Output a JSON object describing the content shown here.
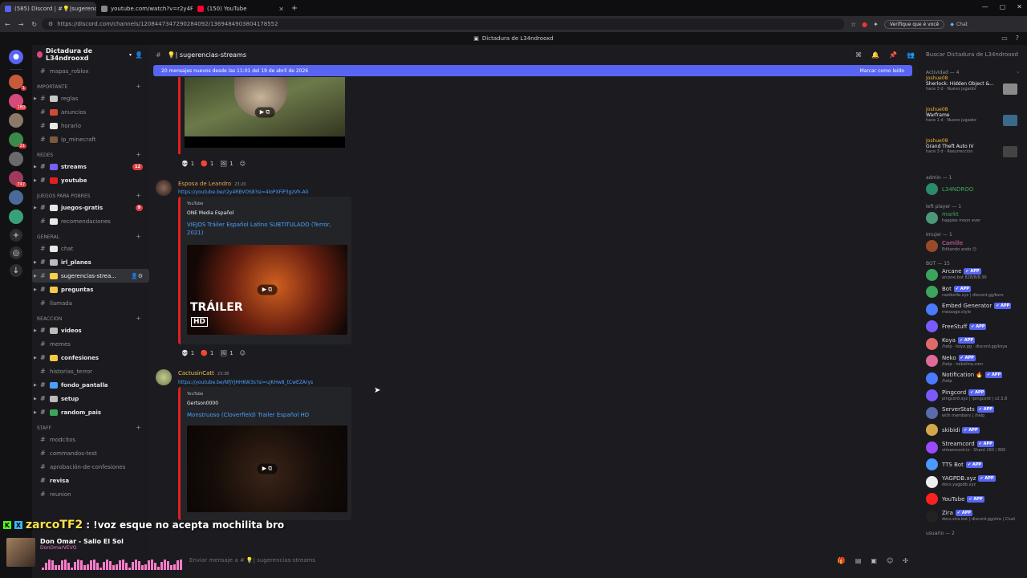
{
  "browser": {
    "tabs": [
      {
        "label": "(585) Discord | #💡|sugerencias-s",
        "color": "#5865f2",
        "active": true
      },
      {
        "label": "youtube.com/watch?v=r2y4RBV",
        "color": "#888",
        "active": false
      },
      {
        "label": "(150) YouTube",
        "color": "#ff0033",
        "active": false
      }
    ],
    "url": "https://discord.com/channels/1208447347290284092/1369484903804178552",
    "verify": "Verifique que é você",
    "chat": "Chat"
  },
  "window_title": "Dictadura de L34ndrooxd",
  "guild": {
    "name": "Dictadura de L34ndrooxd"
  },
  "channels": [
    {
      "kind": "ch",
      "name": "mapas_roblox",
      "emoji_color": "",
      "bold": false
    },
    {
      "kind": "cat",
      "name": "IMPORTANTE"
    },
    {
      "kind": "ch",
      "name": "reglas",
      "emoji_color": "#c8c8c8",
      "arrow": true
    },
    {
      "kind": "ch",
      "name": "anuncios",
      "emoji_color": "#d04a3a"
    },
    {
      "kind": "ch",
      "name": "horario",
      "emoji_color": "#e8e8e8"
    },
    {
      "kind": "ch",
      "name": "ip_minecraft",
      "emoji_color": "#7a5a3a"
    },
    {
      "kind": "cat",
      "name": "REDES"
    },
    {
      "kind": "ch",
      "name": "streams",
      "emoji_color": "#7b5cff",
      "bold": true,
      "arrow": true,
      "badge": "12"
    },
    {
      "kind": "ch",
      "name": "youtube",
      "emoji_color": "#e02020",
      "bold": true,
      "arrow": true
    },
    {
      "kind": "cat",
      "name": "JUEGOS PARA POBRES"
    },
    {
      "kind": "ch",
      "name": "juegos-gratis",
      "emoji_color": "#e8e8e8",
      "bold": true,
      "arrow": true,
      "badge": "9"
    },
    {
      "kind": "ch",
      "name": "recomendaciones",
      "emoji_color": "#e8e8e8"
    },
    {
      "kind": "cat",
      "name": "GENERAL"
    },
    {
      "kind": "ch",
      "name": "chat",
      "emoji_color": "#e8e8e8"
    },
    {
      "kind": "ch",
      "name": "irl_planes",
      "emoji_color": "#bbbbbb",
      "bold": true,
      "arrow": true
    },
    {
      "kind": "ch",
      "name": "sugerencias-strea...",
      "emoji_color": "#f5d04a",
      "selected": true,
      "arrow": true
    },
    {
      "kind": "ch",
      "name": "preguntas",
      "emoji_color": "#f5c84a",
      "bold": true,
      "arrow": true
    },
    {
      "kind": "ch",
      "name": "llamada",
      "emoji_color": ""
    },
    {
      "kind": "cat",
      "name": "REACCION"
    },
    {
      "kind": "ch",
      "name": "videos",
      "emoji_color": "#bbbbbb",
      "bold": true,
      "arrow": true
    },
    {
      "kind": "ch",
      "name": "memes",
      "emoji_color": ""
    },
    {
      "kind": "ch",
      "name": "confesiones",
      "emoji_color": "#f5c84a",
      "bold": true,
      "arrow": true
    },
    {
      "kind": "ch",
      "name": "historias_terror",
      "emoji_color": ""
    },
    {
      "kind": "ch",
      "name": "fondo_pantalla",
      "emoji_color": "#4aa0ff",
      "bold": true,
      "arrow": true
    },
    {
      "kind": "ch",
      "name": "setup",
      "emoji_color": "#bbbbbb",
      "bold": true,
      "arrow": true
    },
    {
      "kind": "ch",
      "name": "random_pais",
      "emoji_color": "#3ba55d",
      "bold": true,
      "arrow": true
    },
    {
      "kind": "cat",
      "name": "STAFF"
    },
    {
      "kind": "ch",
      "name": "modcitos",
      "emoji_color": ""
    },
    {
      "kind": "ch",
      "name": "commandos-test",
      "emoji_color": ""
    },
    {
      "kind": "ch",
      "name": "aprobación-de-confesiones",
      "emoji_color": ""
    },
    {
      "kind": "ch",
      "name": "revisa",
      "emoji_color": "",
      "bold": true
    },
    {
      "kind": "ch",
      "name": "reunion",
      "emoji_color": ""
    }
  ],
  "header": {
    "channel": "💡| sugerencias-streams"
  },
  "banner": {
    "text": "20 mensajes nuevos desde las 11:01 del 19 de abril de 2026",
    "action": "Marcar como leído"
  },
  "messages": [
    {
      "author": "Esposa de Leandro",
      "author_color": "#e8a44a",
      "time": "23:20",
      "link": "https://youtube.be/r2y4RBVOS8?si=4loPXFiP3gzVh-AlI",
      "provider": "YouTube",
      "channel": "ONE Media Español",
      "title": "VIEJOS Tráiler Español Latino SUBTITULADO (Terror, 2021)",
      "overlay": "TRÁILER",
      "overlay2": "HD"
    },
    {
      "author": "CactusinCatt",
      "author_color": "#e8c44a",
      "time": "23:38",
      "link": "https://youtube.be/NfjYJHHKW3s?si=ujKHw8_tCwEZArys",
      "provider": "YouTube",
      "channel": "Gertson0000",
      "title": "Monstruoso (Cloverfield) Trailer Español HD"
    }
  ],
  "reactions": [
    "1",
    "1",
    "1"
  ],
  "composer": {
    "placeholder": "Enviar mensaje a # 💡| sugerencias-streams"
  },
  "members": {
    "search": "Buscar Dictadura de L34ndrooxd",
    "activity_header": "Actividad — 4",
    "activities": [
      {
        "who": "Joshue08",
        "game": "Sherlock: Hidden Object &...",
        "sub": "hace 3 d · Nuevo jugador",
        "color": "#8a8a8a"
      },
      {
        "who": "Joshue08",
        "game": "Warframe",
        "sub": "hace 1 d · Nuevo jugador",
        "color": "#3a6a8a"
      },
      {
        "who": "Joshue08",
        "game": "Grand Theft Auto IV",
        "sub": "hace 3 d · Resurrección",
        "color": "#444"
      }
    ],
    "groups": [
      {
        "title": "admin — 1",
        "items": [
          {
            "name": "L34NDROO",
            "status": "",
            "color": "#3ba55d",
            "av": "#2a8a6a",
            "app": false
          }
        ]
      },
      {
        "title": "left player — 1",
        "items": [
          {
            "name": "markt",
            "status": "happies moon ever",
            "color": "#3ba55d",
            "av": "#4a9a7a",
            "app": false
          }
        ]
      },
      {
        "title": "Imujer — 1",
        "items": [
          {
            "name": "Camille",
            "status": "Editando ando 😏",
            "color": "#e86ab0",
            "av": "#9a4a2a",
            "app": false
          }
        ]
      },
      {
        "title": "BOT — 15",
        "items": [
          {
            "name": "Arcane",
            "status": "arcane.bot  828/8/8.36",
            "color": "#dbdee1",
            "av": "#3ba55d",
            "app": true
          },
          {
            "name": "Bot",
            "status": "castbotle.xyz | discord.gg/bxrs",
            "color": "#dbdee1",
            "av": "#3ba55d",
            "app": true
          },
          {
            "name": "Embed Generator",
            "status": "message.style",
            "color": "#dbdee1",
            "av": "#4a7aff",
            "app": true
          },
          {
            "name": "FreeStuff",
            "status": "",
            "color": "#dbdee1",
            "av": "#7a5aff",
            "app": true
          },
          {
            "name": "Koya",
            "status": "/help · koya.gg · discord.gg/koya",
            "color": "#dbdee1",
            "av": "#e06a6a",
            "app": true
          },
          {
            "name": "Neko",
            "status": "/help · nekotina.com",
            "color": "#dbdee1",
            "av": "#e06a9a",
            "app": true
          },
          {
            "name": "Notification 🔥",
            "status": "/help",
            "color": "#dbdee1",
            "av": "#4a7aff",
            "app": true
          },
          {
            "name": "Pingcord",
            "status": "pingcord.xyz | !pingcord | v2.3.8",
            "color": "#dbdee1",
            "av": "#7a5aff",
            "app": true
          },
          {
            "name": "ServerStats",
            "status": "with members | /help",
            "color": "#dbdee1",
            "av": "#5a6aaa",
            "app": true
          },
          {
            "name": "skibidi",
            "status": "",
            "color": "#dbdee1",
            "av": "#d4a84a",
            "app": true
          },
          {
            "name": "Streamcord",
            "status": "streamcord.io · Shard 280 / 800",
            "color": "#dbdee1",
            "av": "#9a4aff",
            "app": true
          },
          {
            "name": "TTS Bot",
            "status": "",
            "color": "#dbdee1",
            "av": "#4a9aff",
            "app": true
          },
          {
            "name": "YAGPDB.xyz",
            "status": "docs.yagpdb.xyz",
            "color": "#dbdee1",
            "av": "#eeeeee",
            "app": true
          },
          {
            "name": "YouTube",
            "status": "",
            "color": "#dbdee1",
            "av": "#ff2020",
            "app": true
          },
          {
            "name": "Zira",
            "status": "docs.zira.bot | discord.gg/zira | Clust",
            "color": "#dbdee1",
            "av": "#222",
            "app": true
          }
        ]
      },
      {
        "title": "usuario — 2",
        "items": []
      }
    ]
  },
  "overlay": {
    "chat_user": "zarcoTF2",
    "chat_msg": ": !voz esque no acepta mochilita bro",
    "song": "Don Omar - Salio El Sol",
    "artist": "DonOmarVEVO"
  }
}
